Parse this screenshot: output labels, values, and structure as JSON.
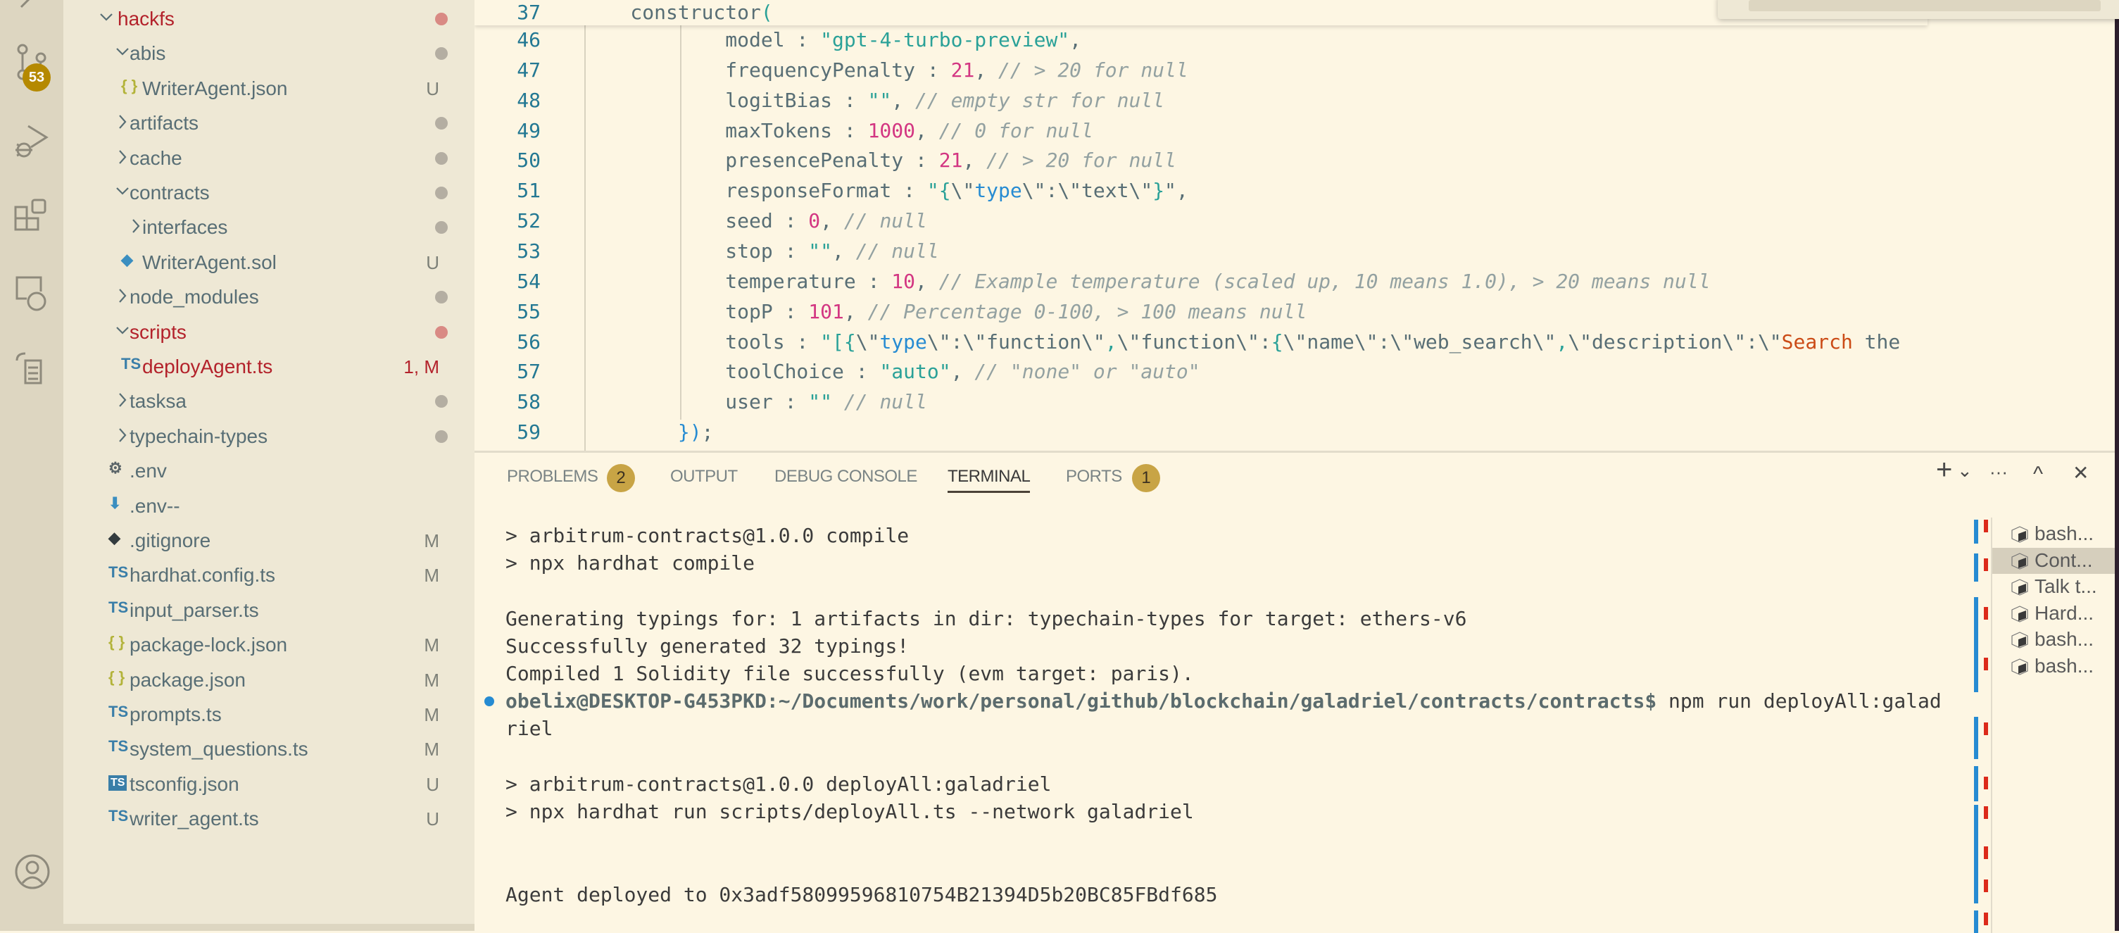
{
  "activity_bar": {
    "items": [
      {
        "name": "explorer",
        "icon": "files-icon"
      },
      {
        "name": "source-control",
        "icon": "source-control-icon",
        "badge": "53"
      },
      {
        "name": "run-debug",
        "icon": "debug-icon"
      },
      {
        "name": "extensions",
        "icon": "extensions-icon"
      },
      {
        "name": "remote-explorer",
        "icon": "remote-explorer-icon"
      },
      {
        "name": "tasks",
        "icon": "tasks-icon"
      }
    ],
    "account_icon": "account-icon"
  },
  "explorer": {
    "items": [
      {
        "label": "hackfs",
        "type": "folder",
        "open": true,
        "depth": 0,
        "status": "error",
        "deco": "dot"
      },
      {
        "label": "abis",
        "type": "folder",
        "open": true,
        "depth": 1,
        "deco": "dot"
      },
      {
        "label": "WriterAgent.json",
        "type": "json",
        "depth": 2,
        "deco": "U"
      },
      {
        "label": "artifacts",
        "type": "folder",
        "open": false,
        "depth": 1,
        "deco": "dot"
      },
      {
        "label": "cache",
        "type": "folder",
        "open": false,
        "depth": 1,
        "deco": "dot"
      },
      {
        "label": "contracts",
        "type": "folder",
        "open": true,
        "depth": 1,
        "deco": "dot"
      },
      {
        "label": "interfaces",
        "type": "folder",
        "open": false,
        "depth": 2,
        "deco": "dot"
      },
      {
        "label": "WriterAgent.sol",
        "type": "sol",
        "depth": 2,
        "deco": "U"
      },
      {
        "label": "node_modules",
        "type": "folder",
        "open": false,
        "depth": 1,
        "deco": "dot"
      },
      {
        "label": "scripts",
        "type": "folder",
        "open": true,
        "depth": 1,
        "status": "error",
        "deco": "dot"
      },
      {
        "label": "deployAgent.ts",
        "type": "ts",
        "depth": 2,
        "status": "error",
        "deco": "1, M"
      },
      {
        "label": "tasksa",
        "type": "folder",
        "open": false,
        "depth": 1,
        "deco": "dot"
      },
      {
        "label": "typechain-types",
        "type": "folder",
        "open": false,
        "depth": 1,
        "deco": "dot"
      },
      {
        "label": ".env",
        "type": "gear",
        "depth": 1,
        "deco": ""
      },
      {
        "label": ".env--",
        "type": "download",
        "depth": 1,
        "deco": ""
      },
      {
        "label": ".gitignore",
        "type": "git",
        "depth": 1,
        "deco": "M"
      },
      {
        "label": "hardhat.config.ts",
        "type": "ts",
        "depth": 1,
        "deco": "M"
      },
      {
        "label": "input_parser.ts",
        "type": "ts",
        "depth": 1,
        "deco": ""
      },
      {
        "label": "package-lock.json",
        "type": "json",
        "depth": 1,
        "deco": "M"
      },
      {
        "label": "package.json",
        "type": "json",
        "depth": 1,
        "deco": "M"
      },
      {
        "label": "prompts.ts",
        "type": "ts",
        "depth": 1,
        "deco": "M"
      },
      {
        "label": "system_questions.ts",
        "type": "ts",
        "depth": 1,
        "deco": "M"
      },
      {
        "label": "tsconfig.json",
        "type": "tsconfig",
        "depth": 1,
        "deco": "U"
      },
      {
        "label": "writer_agent.ts",
        "type": "ts",
        "depth": 1,
        "deco": "U"
      }
    ]
  },
  "editor": {
    "sticky": {
      "num": "37",
      "tokens": [
        {
          "t": "    constructor",
          "c": "p"
        },
        {
          "t": "(",
          "c": "b"
        }
      ]
    },
    "lines": [
      {
        "num": "46",
        "tokens": [
          {
            "t": "            model : ",
            "c": "p"
          },
          {
            "t": "\"gpt-4-turbo-preview\"",
            "c": "s"
          },
          {
            "t": ",",
            "c": "p"
          }
        ]
      },
      {
        "num": "47",
        "tokens": [
          {
            "t": "            frequencyPenalty : ",
            "c": "p"
          },
          {
            "t": "21",
            "c": "n"
          },
          {
            "t": ", ",
            "c": "p"
          },
          {
            "t": "// > 20 for null",
            "c": "c"
          }
        ]
      },
      {
        "num": "48",
        "tokens": [
          {
            "t": "            logitBias : ",
            "c": "p"
          },
          {
            "t": "\"\"",
            "c": "s"
          },
          {
            "t": ", ",
            "c": "p"
          },
          {
            "t": "// empty str for null",
            "c": "c"
          }
        ]
      },
      {
        "num": "49",
        "tokens": [
          {
            "t": "            maxTokens : ",
            "c": "p"
          },
          {
            "t": "1000",
            "c": "n"
          },
          {
            "t": ", ",
            "c": "p"
          },
          {
            "t": "// 0 for null",
            "c": "c"
          }
        ]
      },
      {
        "num": "50",
        "tokens": [
          {
            "t": "            presencePenalty : ",
            "c": "p"
          },
          {
            "t": "21",
            "c": "n"
          },
          {
            "t": ", ",
            "c": "p"
          },
          {
            "t": "// > 20 for null",
            "c": "c"
          }
        ]
      },
      {
        "num": "51",
        "tokens": [
          {
            "t": "            responseFormat : ",
            "c": "p"
          },
          {
            "t": "\"",
            "c": "s"
          },
          {
            "t": "{",
            "c": "b"
          },
          {
            "t": "\\\"",
            "c": "p"
          },
          {
            "t": "type",
            "c": "kw"
          },
          {
            "t": "\\\":\\\"text\\\"",
            "c": "p"
          },
          {
            "t": "}",
            "c": "b"
          },
          {
            "t": "\",",
            "c": "p"
          }
        ]
      },
      {
        "num": "52",
        "tokens": [
          {
            "t": "            seed : ",
            "c": "p"
          },
          {
            "t": "0",
            "c": "n"
          },
          {
            "t": ", ",
            "c": "p"
          },
          {
            "t": "// null",
            "c": "c"
          }
        ]
      },
      {
        "num": "53",
        "tokens": [
          {
            "t": "            stop : ",
            "c": "p"
          },
          {
            "t": "\"\"",
            "c": "s"
          },
          {
            "t": ", ",
            "c": "p"
          },
          {
            "t": "// null",
            "c": "c"
          }
        ]
      },
      {
        "num": "54",
        "tokens": [
          {
            "t": "            temperature : ",
            "c": "p"
          },
          {
            "t": "10",
            "c": "n"
          },
          {
            "t": ", ",
            "c": "p"
          },
          {
            "t": "// Example temperature (scaled up, 10 means 1.0), > 20 means null",
            "c": "c"
          }
        ]
      },
      {
        "num": "55",
        "tokens": [
          {
            "t": "            topP : ",
            "c": "p"
          },
          {
            "t": "101",
            "c": "n"
          },
          {
            "t": ", ",
            "c": "p"
          },
          {
            "t": "// Percentage 0-100, > 100 means null",
            "c": "c"
          }
        ]
      },
      {
        "num": "56",
        "tokens": [
          {
            "t": "            tools : ",
            "c": "p"
          },
          {
            "t": "\"",
            "c": "s"
          },
          {
            "t": "[{",
            "c": "b"
          },
          {
            "t": "\\\"",
            "c": "p"
          },
          {
            "t": "type",
            "c": "kw"
          },
          {
            "t": "\\\":\\\"function\\\"",
            "c": "p"
          },
          {
            "t": ",",
            "c": "b"
          },
          {
            "t": "\\\"function\\\":",
            "c": "p"
          },
          {
            "t": "{",
            "c": "b"
          },
          {
            "t": "\\\"name\\\":\\\"web_search\\\"",
            "c": "p"
          },
          {
            "t": ",",
            "c": "b"
          },
          {
            "t": "\\\"description\\\":\\\"",
            "c": "p"
          },
          {
            "t": "Search",
            "c": "o"
          },
          {
            "t": " the",
            "c": "p"
          }
        ]
      },
      {
        "num": "57",
        "tokens": [
          {
            "t": "            toolChoice : ",
            "c": "p"
          },
          {
            "t": "\"auto\"",
            "c": "s"
          },
          {
            "t": ", ",
            "c": "p"
          },
          {
            "t": "// \"none\" or \"auto\"",
            "c": "c"
          }
        ]
      },
      {
        "num": "58",
        "tokens": [
          {
            "t": "            user : ",
            "c": "p"
          },
          {
            "t": "\"\"",
            "c": "s"
          },
          {
            "t": " ",
            "c": "p"
          },
          {
            "t": "// null",
            "c": "c"
          }
        ]
      },
      {
        "num": "59",
        "tokens": [
          {
            "t": "        ",
            "c": "p"
          },
          {
            "t": "})",
            "c": "kw"
          },
          {
            "t": ";",
            "c": "p"
          }
        ]
      }
    ]
  },
  "panel": {
    "tabs": [
      {
        "label": "PROBLEMS",
        "badge": "2"
      },
      {
        "label": "OUTPUT"
      },
      {
        "label": "DEBUG CONSOLE"
      },
      {
        "label": "TERMINAL",
        "active": true
      },
      {
        "label": "PORTS",
        "badge": "1"
      }
    ],
    "actions": {
      "new_terminal": "+",
      "dropdown": "⌄",
      "more": "···",
      "maximize": "^",
      "close": "✕"
    },
    "terminal": {
      "lines": [
        {
          "text": "> arbitrum-contracts@1.0.0 compile"
        },
        {
          "text": "> npx hardhat compile"
        },
        {
          "text": ""
        },
        {
          "text": "Generating typings for: 1 artifacts in dir: typechain-types for target: ethers-v6"
        },
        {
          "text": "Successfully generated 32 typings!"
        },
        {
          "text": "Compiled 1 Solidity file successfully (evm target: paris)."
        },
        {
          "prompt": "obelix@DESKTOP-G453PKD:~/Documents/work/personal/github/blockchain/galadriel/contracts/contracts$",
          "text": " npm run deployAll:galad"
        },
        {
          "text": "riel"
        },
        {
          "text": ""
        },
        {
          "text": "> arbitrum-contracts@1.0.0 deployAll:galadriel"
        },
        {
          "text": "> npx hardhat run scripts/deployAll.ts --network galadriel"
        },
        {
          "text": ""
        },
        {
          "text": ""
        },
        {
          "text": "Agent deployed to 0x3adf58099596810754B21394D5b20BC85FBdf685"
        }
      ],
      "sessions": [
        {
          "label": "bash..."
        },
        {
          "label": "Cont...",
          "selected": true
        },
        {
          "label": "Talk t..."
        },
        {
          "label": "Hard..."
        },
        {
          "label": "bash..."
        },
        {
          "label": "bash..."
        }
      ]
    }
  },
  "colors": {
    "accent_badge": "#b58900",
    "panel_badge": "#c8a445",
    "error": "#b3222b",
    "string": "#2aa198",
    "number": "#d33682",
    "comment": "#93a1a1",
    "line_number": "#237893"
  }
}
